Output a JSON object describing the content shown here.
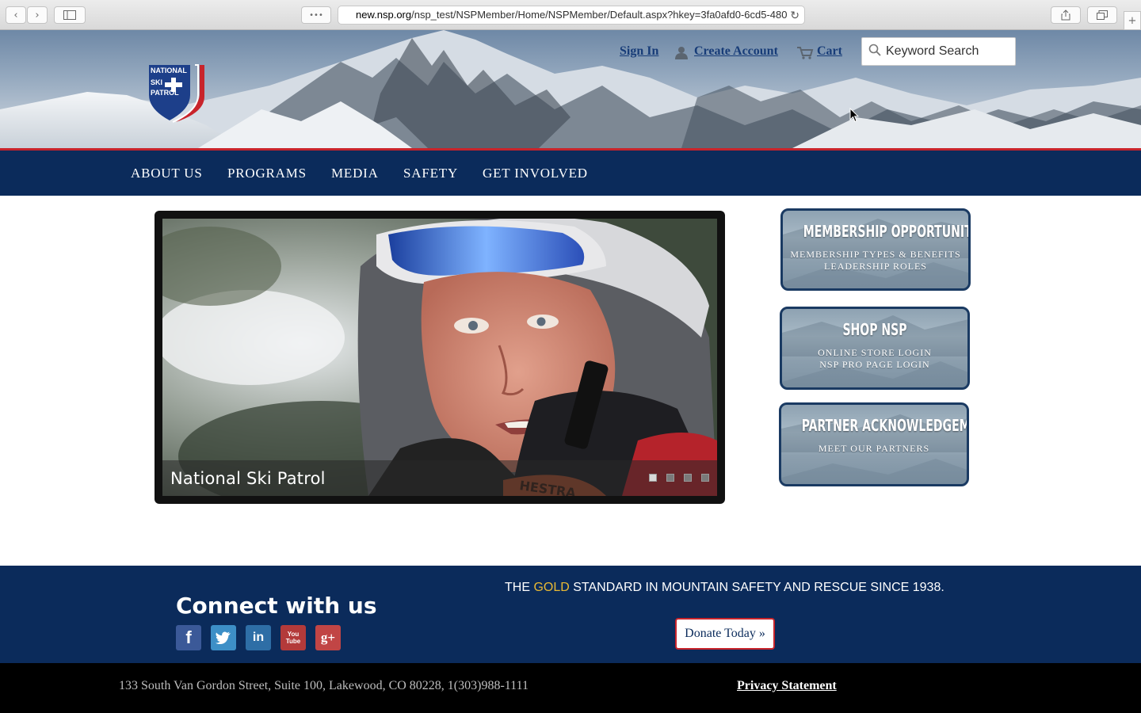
{
  "browser": {
    "url_domain": "new.nsp.org",
    "url_path": "/nsp_test/NSPMember/Home/NSPMember/Default.aspx?hkey=3fa0afd0-6cd5-480"
  },
  "header": {
    "logo_text": [
      "NATIONAL",
      "SKI",
      "PATROL"
    ],
    "sign_in": "Sign In",
    "create_account": "Create Account",
    "cart": "Cart",
    "search_placeholder": "Keyword Search"
  },
  "nav": {
    "items": [
      "ABOUT US",
      "PROGRAMS",
      "MEDIA",
      "SAFETY",
      "GET INVOLVED"
    ]
  },
  "slider": {
    "caption": "National Ski Patrol",
    "slide_count": 4,
    "active_slide": 1
  },
  "cards": [
    {
      "title": "MEMBERSHIP OPPORTUNITIES",
      "lines": [
        "MEMBERSHIP TYPES & BENEFITS",
        "LEADERSHIP ROLES"
      ]
    },
    {
      "title": "SHOP NSP",
      "lines": [
        "ONLINE STORE LOGIN",
        "NSP PRO PAGE LOGIN"
      ]
    },
    {
      "title": "PARTNER ACKNOWLEDGEMENT",
      "lines": [
        "MEET OUR PARTNERS"
      ]
    }
  ],
  "footer": {
    "connect_title": "Connect with us",
    "tagline_before": "THE ",
    "tagline_gold": "GOLD",
    "tagline_after": " STANDARD IN MOUNTAIN SAFETY AND RESCUE SINCE 1938.",
    "donate": "Donate Today »",
    "social": [
      {
        "name": "facebook",
        "glyph": "f",
        "color": "#3b5998"
      },
      {
        "name": "twitter",
        "glyph": "🐦",
        "color": "#3d8fc7"
      },
      {
        "name": "linkedin",
        "glyph": "in",
        "color": "#2e6ea6"
      },
      {
        "name": "youtube",
        "glyph": "You Tube",
        "color": "#b33a3a"
      },
      {
        "name": "googleplus",
        "glyph": "g+",
        "color": "#c14545"
      }
    ],
    "address": "133 South Van Gordon Street, Suite 100, Lakewood, CO 80228, 1(303)988-1111",
    "privacy": "Privacy Statement"
  },
  "colors": {
    "navy": "#0b2b5b",
    "red": "#c8242b",
    "gold": "#e9b934"
  }
}
